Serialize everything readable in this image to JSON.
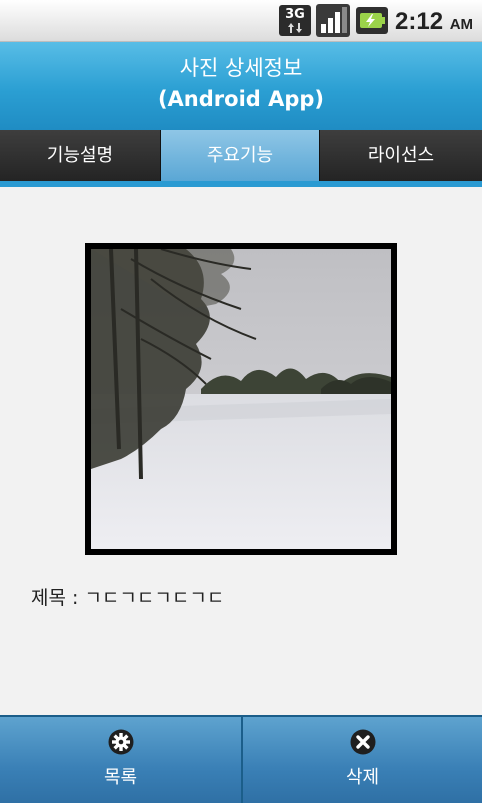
{
  "status_bar": {
    "network": "3G",
    "time": "2:12",
    "ampm": "AM"
  },
  "header": {
    "title_line1": "사진 상세정보",
    "title_line2": "(Android App)"
  },
  "tabs": [
    {
      "label": "기능설명",
      "selected": false
    },
    {
      "label": "주요기능",
      "selected": true
    },
    {
      "label": "라이선스",
      "selected": false
    }
  ],
  "detail": {
    "title_label": "제목 : ",
    "title_value": "ㄱㄷㄱㄷㄱㄷㄱㄷ"
  },
  "bottom_bar": {
    "list_label": "목록",
    "delete_label": "삭제"
  },
  "colors": {
    "accent": "#2b9fd3",
    "tab_selected": "#5aa7d5"
  }
}
